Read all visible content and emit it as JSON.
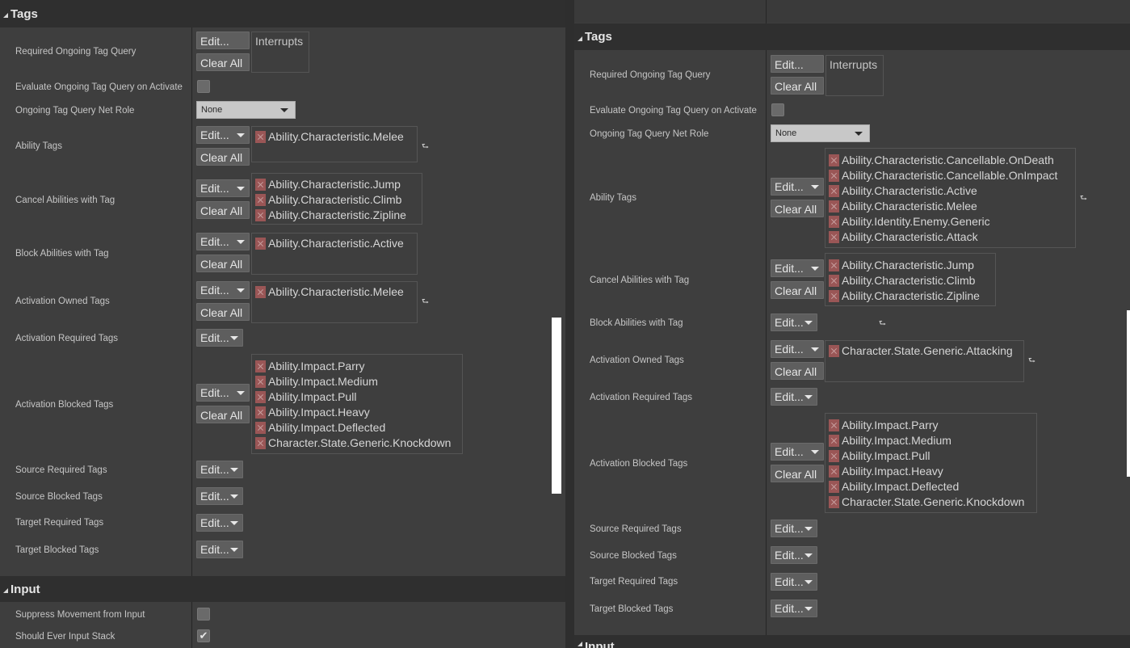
{
  "left": {
    "sections": {
      "tags": "Tags",
      "input": "Input"
    },
    "labels": {
      "required_ongoing_tag_query": "Required Ongoing Tag Query",
      "evaluate_ongoing": "Evaluate Ongoing Tag Query on Activate",
      "ongoing_net_role": "Ongoing Tag Query Net Role",
      "ability_tags": "Ability Tags",
      "cancel_abilities": "Cancel Abilities with Tag",
      "block_abilities": "Block Abilities with Tag",
      "activation_owned": "Activation Owned Tags",
      "activation_required": "Activation Required Tags",
      "activation_blocked": "Activation Blocked Tags",
      "source_required": "Source Required Tags",
      "source_blocked": "Source Blocked Tags",
      "target_required": "Target Required Tags",
      "target_blocked": "Target Blocked Tags",
      "suppress_movement": "Suppress Movement from Input",
      "should_ever_input_stack": "Should Ever Input Stack"
    },
    "buttons": {
      "edit": "Edit...",
      "clear_all": "Clear All"
    },
    "query_text": "Interrupts",
    "net_role_value": "None",
    "ability_tags": [
      "Ability.Characteristic.Melee"
    ],
    "cancel_tags": [
      "Ability.Characteristic.Jump",
      "Ability.Characteristic.Climb",
      "Ability.Characteristic.Zipline"
    ],
    "block_tags": [
      "Ability.Characteristic.Active"
    ],
    "owned_tags": [
      "Ability.Characteristic.Melee"
    ],
    "blocked_tags": [
      "Ability.Impact.Parry",
      "Ability.Impact.Medium",
      "Ability.Impact.Pull",
      "Ability.Impact.Heavy",
      "Ability.Impact.Deflected",
      "Character.State.Generic.Knockdown"
    ],
    "evaluate_checked": false,
    "suppress_checked": false,
    "input_stack_checked": true,
    "check_glyph": "✔"
  },
  "right": {
    "sections": {
      "tags": "Tags",
      "input": "Input"
    },
    "labels": {
      "required_ongoing_tag_query": "Required Ongoing Tag Query",
      "evaluate_ongoing": "Evaluate Ongoing Tag Query on Activate",
      "ongoing_net_role": "Ongoing Tag Query Net Role",
      "ability_tags": "Ability Tags",
      "cancel_abilities": "Cancel Abilities with Tag",
      "block_abilities": "Block Abilities with Tag",
      "activation_owned": "Activation Owned Tags",
      "activation_required": "Activation Required Tags",
      "activation_blocked": "Activation Blocked Tags",
      "source_required": "Source Required Tags",
      "source_blocked": "Source Blocked Tags",
      "target_required": "Target Required Tags",
      "target_blocked": "Target Blocked Tags"
    },
    "buttons": {
      "edit": "Edit...",
      "clear_all": "Clear All"
    },
    "query_text": "Interrupts",
    "net_role_value": "None",
    "ability_tags": [
      "Ability.Characteristic.Cancellable.OnDeath",
      "Ability.Characteristic.Cancellable.OnImpact",
      "Ability.Characteristic.Active",
      "Ability.Characteristic.Melee",
      "Ability.Identity.Enemy.Generic",
      "Ability.Characteristic.Attack"
    ],
    "cancel_tags": [
      "Ability.Characteristic.Jump",
      "Ability.Characteristic.Climb",
      "Ability.Characteristic.Zipline"
    ],
    "owned_tags": [
      "Character.State.Generic.Attacking"
    ],
    "blocked_tags": [
      "Ability.Impact.Parry",
      "Ability.Impact.Medium",
      "Ability.Impact.Pull",
      "Ability.Impact.Heavy",
      "Ability.Impact.Deflected",
      "Character.State.Generic.Knockdown"
    ],
    "evaluate_checked": false
  },
  "icons": {
    "expand_arrow": "collapse-arrow-icon",
    "return": "return-arrow-icon",
    "remove_tag": "remove-tag-icon",
    "dropdown": "dropdown-arrow-icon"
  }
}
